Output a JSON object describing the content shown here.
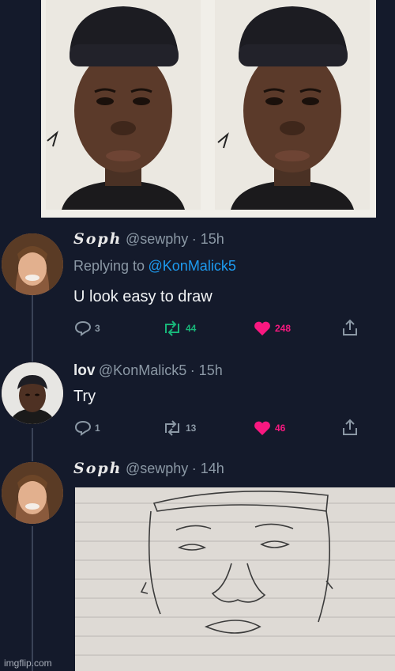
{
  "tweets": [
    {
      "display_name": "Soph",
      "handle": "@sewphy",
      "time": "· 15h",
      "replying_prefix": "Replying to",
      "replying_to": "@KonMalick5",
      "text": "U look easy to draw",
      "replies": "3",
      "retweets": "44",
      "likes": "248"
    },
    {
      "display_name": "lov",
      "handle": "@KonMalick5",
      "time": "· 15h",
      "text": "Try",
      "replies": "1",
      "retweets": "13",
      "likes": "46"
    },
    {
      "display_name": "Soph",
      "handle": "@sewphy",
      "time": "· 14h"
    }
  ],
  "watermark": "imgflip.com",
  "colors": {
    "background": "#141a2b",
    "link": "#1d9bf0",
    "retweet": "#18b679",
    "like": "#f91880",
    "muted": "#8b98a5"
  }
}
